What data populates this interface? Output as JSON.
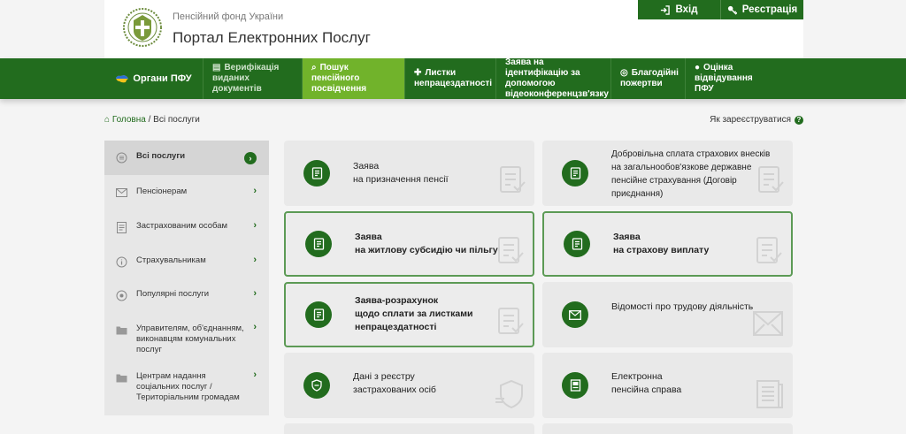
{
  "header": {
    "org": "Пенсійний фонд України",
    "portal": "Портал Електронних Послуг",
    "login": "Вхід",
    "register": "Реєстрація"
  },
  "nav": [
    {
      "label": "Органи ПФУ",
      "icon": "ukraine-map-icon",
      "active": false
    },
    {
      "label": "Верифікація виданих документів",
      "icon": "checklist-icon",
      "active": false
    },
    {
      "label": "Пошук пенсійного посвідчення",
      "icon": "search-icon",
      "active": true
    },
    {
      "label": "Листки непрацездатності",
      "icon": "medkit-icon",
      "active": false
    },
    {
      "label": "Заява на ідентифікацію за допомогою відеоконференцзв'язку",
      "icon": "",
      "active": false
    },
    {
      "label": "Благодійні пожертви",
      "icon": "coins-icon",
      "active": false
    },
    {
      "label": "Оцінка відвідування ПФУ",
      "icon": "comment-icon",
      "active": false
    }
  ],
  "breadcrumb": {
    "home": "Головна",
    "separator": "/",
    "current": "Всі послуги"
  },
  "help_link": "Як зареєструватися",
  "sidebar": [
    {
      "label": "Всі послуги",
      "icon": "all-services-icon",
      "active": true
    },
    {
      "label": "Пенсіонерам",
      "icon": "envelope-icon",
      "active": false
    },
    {
      "label": "Застрахованим особам",
      "icon": "document-icon",
      "active": false
    },
    {
      "label": "Страхувальникам",
      "icon": "info-icon",
      "active": false
    },
    {
      "label": "Популярні послуги",
      "icon": "popular-icon",
      "active": false
    },
    {
      "label": "Управителям, об'єднанням, виконавцям комунальних послуг",
      "icon": "folder-icon",
      "active": false
    },
    {
      "label": "Центрам надання соціальних послуг / Територіальним громадам",
      "icon": "folder-icon",
      "active": false
    }
  ],
  "cards": [
    {
      "lines": [
        "Заява",
        "на призначення пенсії"
      ],
      "highlighted": false,
      "icon": "application-form-icon"
    },
    {
      "lines": [
        "Добровільна сплата страхових внесків",
        "на загальнообов'язкове державне",
        "пенсійне страхування (Договір",
        "приєднання)"
      ],
      "highlighted": false,
      "icon": "application-form-icon"
    },
    {
      "lines": [
        "Заява",
        "на житлову субсидію чи пільгу"
      ],
      "highlighted": true,
      "icon": "application-form-icon"
    },
    {
      "lines": [
        "Заява",
        "на страхову виплату"
      ],
      "highlighted": true,
      "icon": "application-form-icon"
    },
    {
      "lines": [
        "Заява-розрахунок",
        "щодо сплати за листками",
        "непрацездатності"
      ],
      "highlighted": true,
      "icon": "application-form-icon"
    },
    {
      "lines": [
        "Відомості про трудову діяльність"
      ],
      "highlighted": false,
      "icon": "envelope-icon"
    },
    {
      "lines": [
        "Дані з реєстру",
        "застрахованих осіб"
      ],
      "highlighted": false,
      "icon": "shield-register-icon"
    },
    {
      "lines": [
        "Електронна",
        "пенсійна справа"
      ],
      "highlighted": false,
      "icon": "case-file-icon"
    }
  ],
  "colors": {
    "primary": "#226c1e",
    "active_nav": "#71b32b",
    "card_bg": "#e9e9e9",
    "page_bg": "#f4f4f4"
  }
}
